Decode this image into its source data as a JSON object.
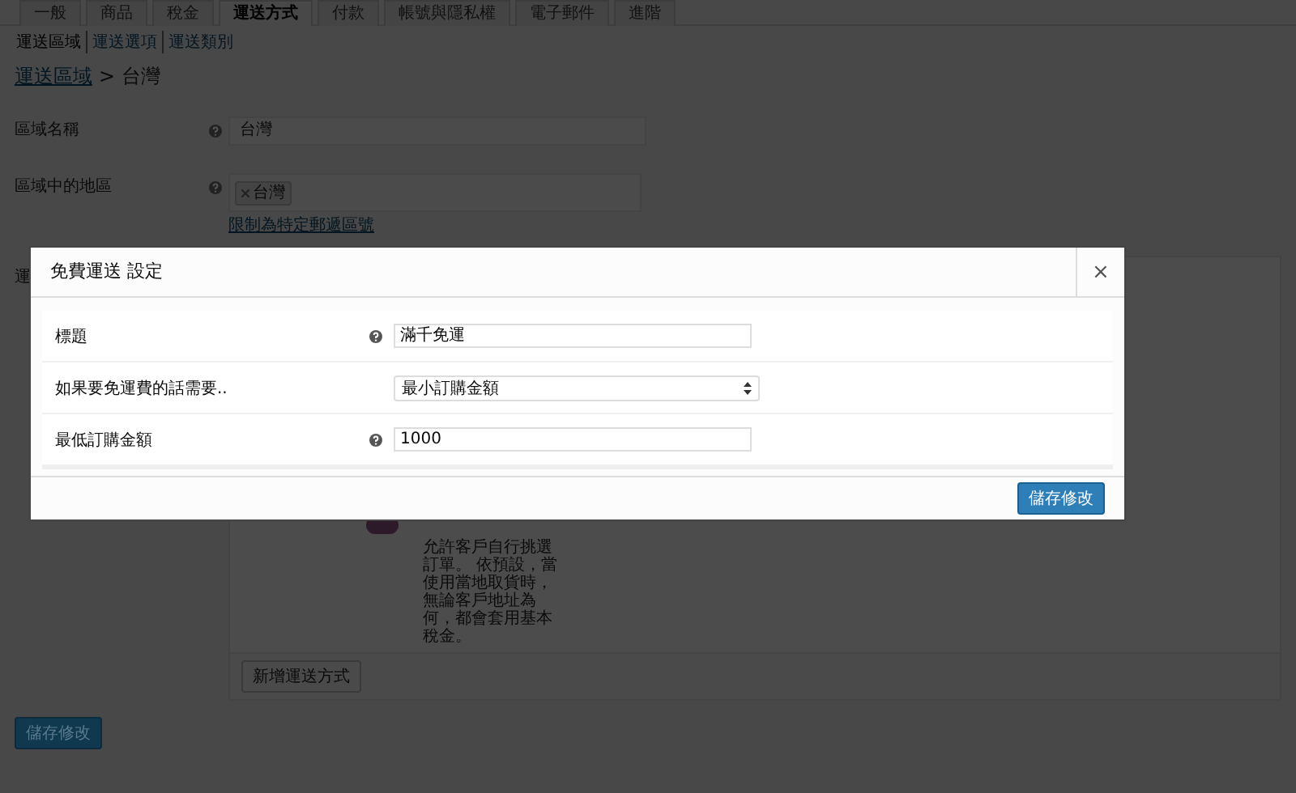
{
  "tabs": [
    {
      "label": "一般",
      "selected": false
    },
    {
      "label": "商品",
      "selected": false
    },
    {
      "label": "稅金",
      "selected": false
    },
    {
      "label": "運送方式",
      "selected": true
    },
    {
      "label": "付款",
      "selected": false
    },
    {
      "label": "帳號與隱私權",
      "selected": false
    },
    {
      "label": "電子郵件",
      "selected": false
    },
    {
      "label": "進階",
      "selected": false
    }
  ],
  "subnav": [
    {
      "label": "運送區域",
      "selected": true
    },
    {
      "label": "運送選項",
      "selected": false
    },
    {
      "label": "運送類別",
      "selected": false
    }
  ],
  "breadcrumb": {
    "link": "運送區域",
    "current": "> 台灣"
  },
  "zone_name": {
    "label": "區域名稱",
    "value": "台灣"
  },
  "zone_regions": {
    "label": "區域中的地區",
    "tags": [
      "台灣"
    ],
    "link": "限制為特定郵遞區號"
  },
  "methods_label": "運",
  "method": {
    "enabled": true,
    "description": "允許客戶自行挑選訂單。 依預設，當使用當地取貨時，無論客戶地址為何，都會套用基本稅金。"
  },
  "add_method_button": "新增運送方式",
  "save_button": "儲存修改",
  "modal": {
    "title": "免費運送 設定",
    "close": "×",
    "fields": [
      {
        "kind": "text",
        "label": "標題",
        "help": true,
        "value": "滿千免運"
      },
      {
        "kind": "select",
        "label": "如果要免運費的話需要..",
        "help": false,
        "value": "最小訂購金額"
      },
      {
        "kind": "text",
        "label": "最低訂購金額",
        "help": true,
        "value": "1000"
      }
    ],
    "save_button": "儲存修改"
  }
}
